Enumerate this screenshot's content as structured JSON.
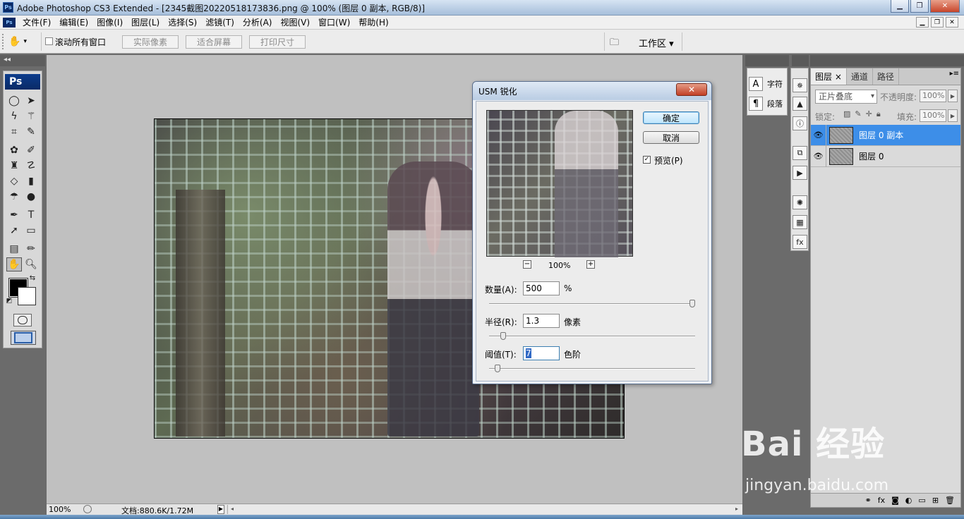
{
  "window": {
    "title": "Adobe Photoshop CS3 Extended - [2345截图20220518173836.png @ 100% (图层 0 副本, RGB/8)]",
    "app_badge": "Ps"
  },
  "menu": [
    "文件(F)",
    "编辑(E)",
    "图像(I)",
    "图层(L)",
    "选择(S)",
    "滤镜(T)",
    "分析(A)",
    "视图(V)",
    "窗口(W)",
    "帮助(H)"
  ],
  "options": {
    "scroll_all_label": "滚动所有窗口",
    "actual_pixels": "实际像素",
    "fit_screen": "适合屏幕",
    "print_size": "打印尺寸",
    "workspace": "工作区 ▾"
  },
  "toolbox": {
    "badge": "Ps"
  },
  "status": {
    "zoom": "100%",
    "doc": "文档:880.6K/1.72M"
  },
  "side_panel": {
    "character": "字符",
    "paragraph": "段落"
  },
  "layers_panel": {
    "tabs": [
      "图层",
      "通道",
      "路径"
    ],
    "tab_close": "×",
    "blend_mode": "正片叠底",
    "opacity_label": "不透明度:",
    "opacity_value": "100%",
    "lock_label": "锁定:",
    "fill_label": "填充:",
    "fill_value": "100%",
    "layers": [
      {
        "name": "图层 0 副本",
        "selected": true
      },
      {
        "name": "图层 0",
        "selected": false
      }
    ]
  },
  "dialog": {
    "title": "USM 锐化",
    "close": "✕",
    "ok": "确定",
    "cancel": "取消",
    "preview_label": "预览(P)",
    "preview_checked": true,
    "zoom": "100%",
    "zoom_out": "−",
    "zoom_in": "+",
    "amount": {
      "label": "数量(A):",
      "value": "500",
      "unit": "%",
      "level": 1.0
    },
    "radius": {
      "label": "半径(R):",
      "value": "1.3",
      "unit": "像素",
      "level": 0.07
    },
    "threshold": {
      "label": "阈值(T):",
      "value": "7",
      "unit": "色阶",
      "level": 0.04
    }
  },
  "watermark": {
    "main": "Bai 经验",
    "sub": "jingyan.baidu.com"
  },
  "colors": {
    "accent": "#3d8ee8",
    "titlebar": "#b9cde4",
    "work_bg": "#c0c0c0",
    "panel_bg": "#6b6b6b"
  }
}
